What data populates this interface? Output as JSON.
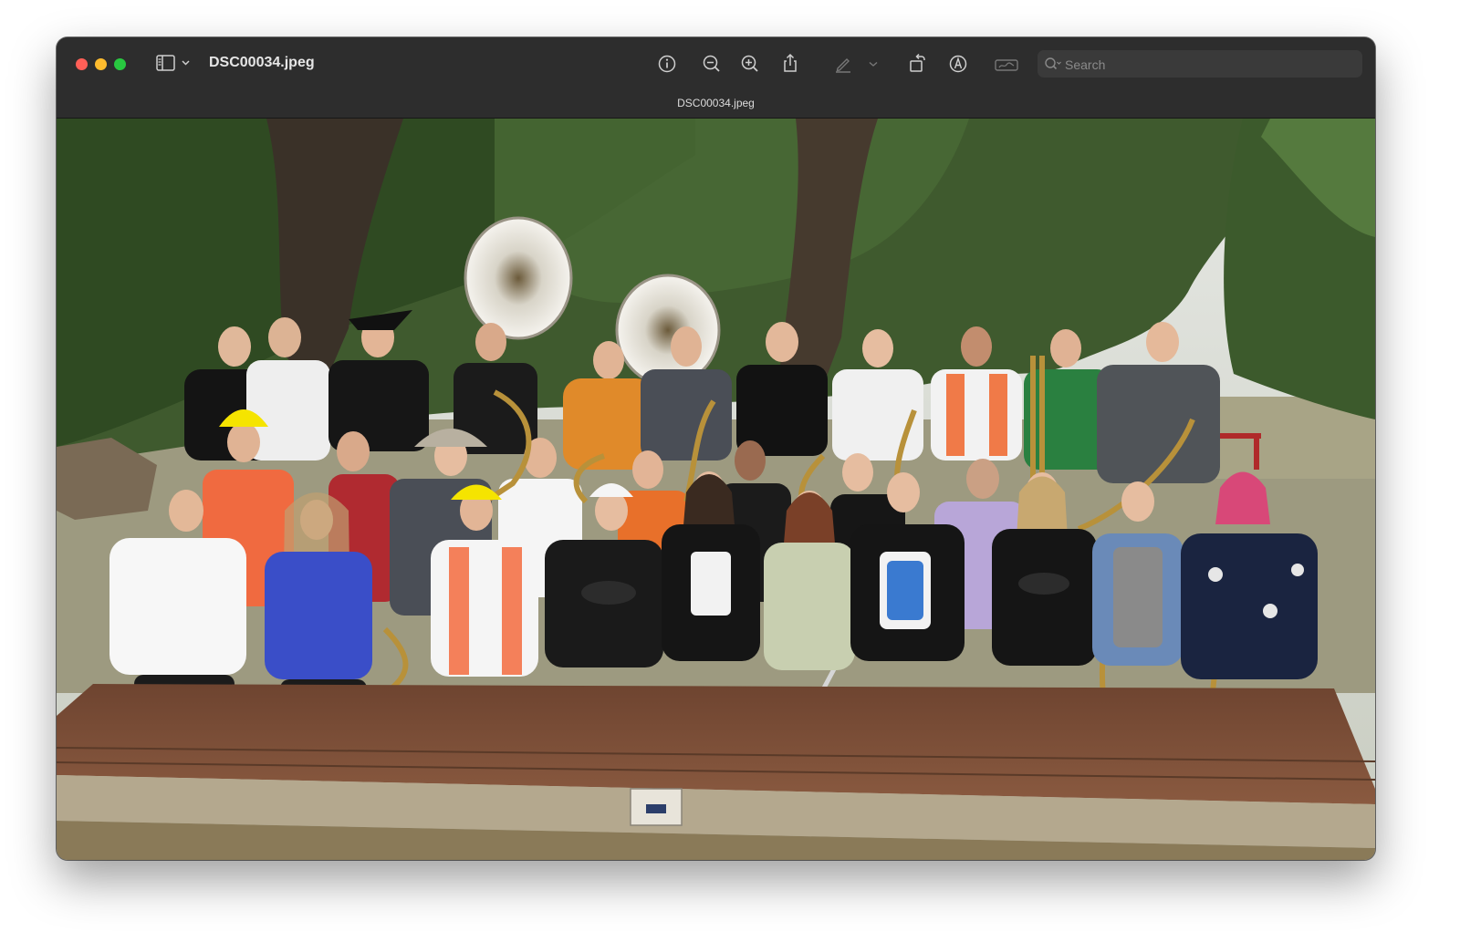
{
  "window": {
    "title": "DSC00034.jpeg",
    "tab_label": "DSC00034.jpeg"
  },
  "toolbar": {
    "search_placeholder": "Search",
    "icons": [
      "sidebar-icon",
      "chevron-down-icon",
      "info-icon",
      "zoom-out-icon",
      "zoom-in-icon",
      "share-icon",
      "markup-pen-icon",
      "chevron-down-icon",
      "rotate-icon",
      "annotate-icon",
      "signature-icon",
      "search-icon"
    ]
  },
  "photo": {
    "plaque_lines": [
      "",
      "",
      "",
      "",
      ""
    ]
  },
  "colors": {
    "close": "#ff5f57",
    "minimize": "#febc2e",
    "maximize": "#28c840",
    "toolbar_bg": "#2d2d2d"
  }
}
